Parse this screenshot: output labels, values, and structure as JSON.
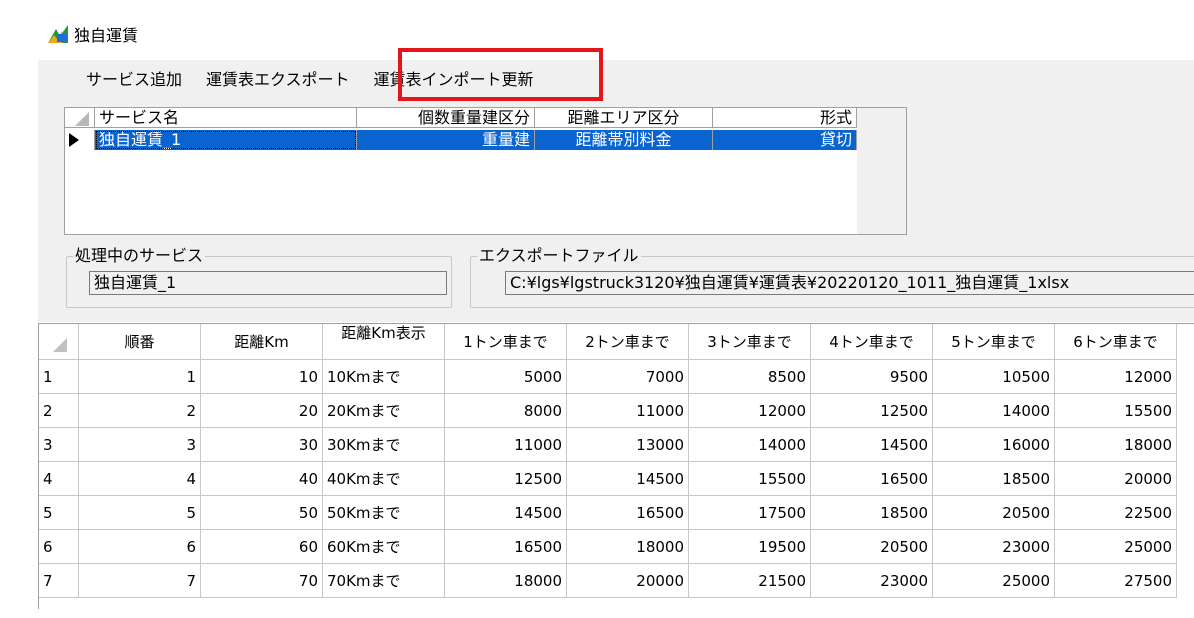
{
  "window": {
    "title": "独自運賃",
    "icon": "app-logo-icon"
  },
  "menu": {
    "items": [
      "サービス追加",
      "運賃表エクスポート",
      "運賃表インポート更新"
    ]
  },
  "services": {
    "columns": [
      "サービス名",
      "個数重量建区分",
      "距離エリア区分",
      "形式"
    ],
    "rows": [
      [
        "独自運賃_1",
        "重量建",
        "距離帯別料金",
        "貸切"
      ]
    ]
  },
  "processing": {
    "label": "処理中のサービス",
    "value": "独自運賃_1"
  },
  "export": {
    "label": "エクスポートファイル",
    "value": "C:¥lgs¥lgstruck3120¥独自運賃¥運賃表¥20220120_1011_独自運賃_1xlsx"
  },
  "grid": {
    "columns": [
      "順番",
      "距離Km",
      "距離Km表示",
      "1トン車まで",
      "2トン車まで",
      "3トン車まで",
      "4トン車まで",
      "5トン車まで",
      "6トン車まで"
    ],
    "rows": [
      [
        "1",
        "1",
        "10",
        "10Kmまで",
        "5000",
        "7000",
        "8500",
        "9500",
        "10500",
        "12000"
      ],
      [
        "2",
        "2",
        "20",
        "20Kmまで",
        "8000",
        "11000",
        "12000",
        "12500",
        "14000",
        "15500"
      ],
      [
        "3",
        "3",
        "30",
        "30Kmまで",
        "11000",
        "13000",
        "14000",
        "14500",
        "16000",
        "18000"
      ],
      [
        "4",
        "4",
        "40",
        "40Kmまで",
        "12500",
        "14500",
        "15500",
        "16500",
        "18500",
        "20000"
      ],
      [
        "5",
        "5",
        "50",
        "50Kmまで",
        "14500",
        "16500",
        "17500",
        "18500",
        "20500",
        "22500"
      ],
      [
        "6",
        "6",
        "60",
        "60Kmまで",
        "16500",
        "18000",
        "19500",
        "20500",
        "23000",
        "25000"
      ],
      [
        "7",
        "7",
        "70",
        "70Kmまで",
        "18000",
        "20000",
        "21500",
        "23000",
        "25000",
        "27500"
      ]
    ]
  }
}
